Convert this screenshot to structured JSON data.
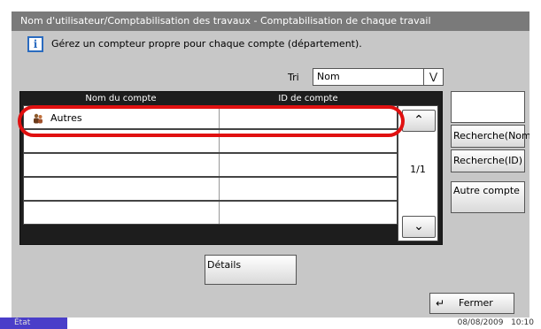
{
  "window": {
    "title": "Nom d'utilisateur/Comptabilisation des travaux - Comptabilisation de chaque travail"
  },
  "info": {
    "icon": "info-icon",
    "icon_glyph": "i",
    "text": "Gérez un compteur propre pour chaque compte (département)."
  },
  "sort": {
    "label": "Tri",
    "value": "Nom"
  },
  "table": {
    "columns": [
      "Nom du compte",
      "ID de compte"
    ],
    "rows": [
      {
        "name": "Autres",
        "id": ""
      },
      {
        "name": "",
        "id": ""
      },
      {
        "name": "",
        "id": ""
      },
      {
        "name": "",
        "id": ""
      },
      {
        "name": "",
        "id": ""
      }
    ],
    "page_indicator": "1/1"
  },
  "side_buttons": {
    "search_name": "Recherche(Nom)",
    "search_id": "Recherche(ID)",
    "other_account": "Autre compte"
  },
  "details_button": "Détails",
  "close_button": "Fermer",
  "status": {
    "label": "État",
    "date": "08/08/2009",
    "time": "10:10"
  },
  "colors": {
    "highlight": "#e01010",
    "status_bar": "#4a3ec9",
    "title_bar": "#7a7a7a"
  }
}
